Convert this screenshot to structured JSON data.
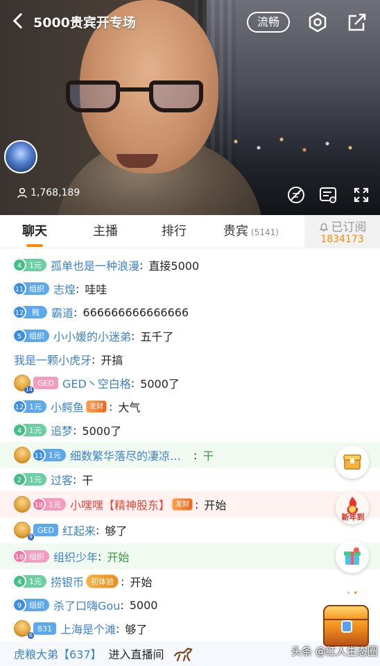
{
  "header": {
    "title": "5000贵宾开专场",
    "quality_label": "流畅"
  },
  "video": {
    "viewer_count": "1,768,189"
  },
  "tabs": [
    {
      "label": "聊天",
      "active": true
    },
    {
      "label": "主播",
      "active": false
    },
    {
      "label": "排行",
      "active": false
    },
    {
      "label": "贵宾",
      "active": false,
      "count": "(5141)"
    }
  ],
  "subscribe": {
    "label": "已订阅",
    "count": "1834173"
  },
  "chat": [
    {
      "level": "4",
      "badge": "1元",
      "user": "孤单也是一种浪漫",
      "text": "直接5000"
    },
    {
      "level": "11",
      "badge": "组织",
      "user": "志煌",
      "text": "哇哇"
    },
    {
      "level": "12",
      "badge": "贱",
      "user": "霸道",
      "text": "666666666666666"
    },
    {
      "level": "5",
      "badge": "组织",
      "user": "小小媛的小迷弟",
      "text": "五千了"
    },
    {
      "user": "我是一颗小虎牙",
      "text": "开搞"
    },
    {
      "guard": "14",
      "badge": "GED",
      "user": "GED丶空白格",
      "text": "5000了"
    },
    {
      "level": "12",
      "badge": "1元",
      "user": "小鳄鱼",
      "tag": "发财",
      "text": "大气"
    },
    {
      "level": "4",
      "badge": "1元",
      "user": "追梦",
      "text": "5000了"
    },
    {
      "level": "11",
      "badge": "1元",
      "user": "细数繁华落尽的凄凉…",
      "text": "干"
    },
    {
      "level": "2",
      "badge": "1元",
      "user": "过客",
      "text": "干"
    },
    {
      "level": "18",
      "badge": "1元",
      "user": "小嘿嘿【精神股东】",
      "tag": "发财",
      "text": "开始"
    },
    {
      "guard": "9",
      "badge": "GED",
      "user": "红起来",
      "text": "够了"
    },
    {
      "level": "18",
      "badge": "组织",
      "user": "组织少年",
      "text": "开始"
    },
    {
      "level": "4",
      "badge": "1元",
      "user": "捞银币",
      "tag": "初体验",
      "text": "开始"
    },
    {
      "level": "9",
      "badge": "组织",
      "user": "杀了口嗨Gou",
      "text": "5000"
    },
    {
      "guard": "6",
      "badge": "831",
      "user": "上海是个滩",
      "text": "够了"
    },
    {
      "user": "虎粮大弟【637】",
      "text": "进入直播间"
    }
  ],
  "side": {
    "new_year_label": "新年到"
  },
  "watermark": "头条 @红人生态圈",
  "colors": {
    "accent": "#ff8a00",
    "username": "#3d82c9",
    "highlight_red": "#e1493a"
  }
}
